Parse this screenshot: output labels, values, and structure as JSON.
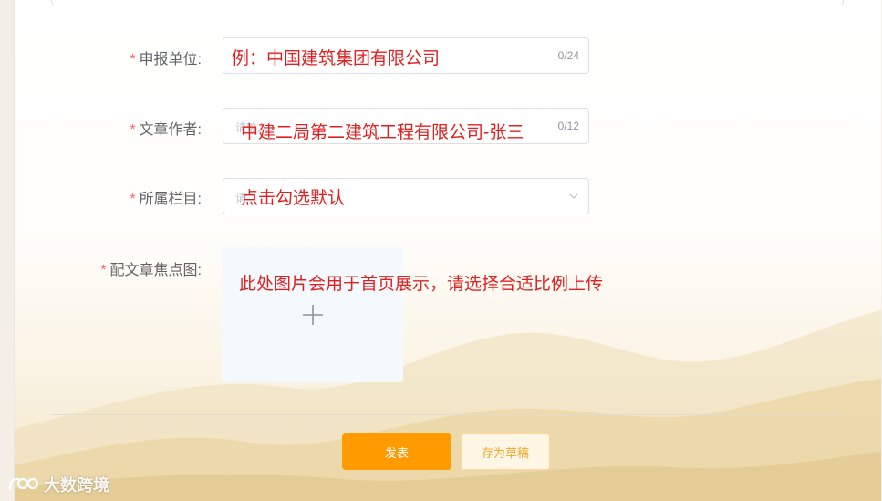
{
  "form": {
    "unit": {
      "required_mark": "*",
      "label": "申报单位:",
      "value": "例：中国建筑集团有限公司",
      "counter": "0/24"
    },
    "author": {
      "required_mark": "*",
      "label": "文章作者:",
      "ghost_text": "请输入",
      "value": "中建二局第二建筑工程有限公司-张三",
      "counter": "0/12"
    },
    "column": {
      "required_mark": "*",
      "label": "所属栏目:",
      "ghost_text": "请",
      "value": "点击勾选默认"
    },
    "cover": {
      "required_mark": "*",
      "label": "配文章焦点图:",
      "note": "此处图片会用于首页展示，请选择合适比例上传"
    }
  },
  "actions": {
    "publish": "发表",
    "draft": "存为草稿"
  },
  "watermark": {
    "text": "大数跨境"
  },
  "colors": {
    "accent": "#ff9b00",
    "annotation_red": "#e02020",
    "required": "#f56c6c"
  }
}
